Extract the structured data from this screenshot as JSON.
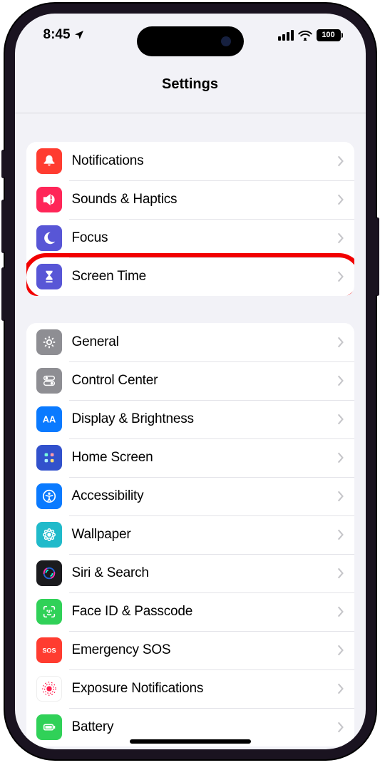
{
  "status": {
    "time": "8:45",
    "battery": "100"
  },
  "header": {
    "title": "Settings"
  },
  "highlighted_row_index": 3,
  "groups": [
    {
      "items": [
        {
          "id": "notifications",
          "label": "Notifications",
          "icon": "bell",
          "bg": "#ff3c30"
        },
        {
          "id": "sounds",
          "label": "Sounds & Haptics",
          "icon": "speaker",
          "bg": "#ff2658"
        },
        {
          "id": "focus",
          "label": "Focus",
          "icon": "moon",
          "bg": "#5856d6"
        },
        {
          "id": "screen-time",
          "label": "Screen Time",
          "icon": "hourglass",
          "bg": "#5856d6"
        }
      ]
    },
    {
      "items": [
        {
          "id": "general",
          "label": "General",
          "icon": "gear",
          "bg": "#8e8e93"
        },
        {
          "id": "control-center",
          "label": "Control Center",
          "icon": "switches",
          "bg": "#8e8e93"
        },
        {
          "id": "display",
          "label": "Display & Brightness",
          "icon": "aa",
          "bg": "#0a7aff"
        },
        {
          "id": "home-screen",
          "label": "Home Screen",
          "icon": "grid",
          "bg": "#3251cc"
        },
        {
          "id": "accessibility",
          "label": "Accessibility",
          "icon": "person-circle",
          "bg": "#0a7aff"
        },
        {
          "id": "wallpaper",
          "label": "Wallpaper",
          "icon": "flower",
          "bg": "#20baca"
        },
        {
          "id": "siri",
          "label": "Siri & Search",
          "icon": "siri",
          "bg": "#1b1b1e"
        },
        {
          "id": "faceid",
          "label": "Face ID & Passcode",
          "icon": "face",
          "bg": "#30d158"
        },
        {
          "id": "sos",
          "label": "Emergency SOS",
          "icon": "sos",
          "bg": "#ff3c30"
        },
        {
          "id": "exposure",
          "label": "Exposure Notifications",
          "icon": "exposure",
          "bg": "#ffffff"
        },
        {
          "id": "battery",
          "label": "Battery",
          "icon": "battery",
          "bg": "#30d158"
        }
      ]
    }
  ]
}
